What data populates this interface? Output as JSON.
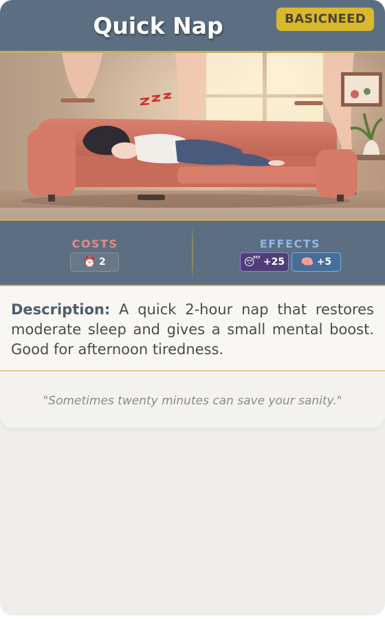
{
  "card": {
    "title": "Quick Nap",
    "type_badge": "BASICNEED",
    "colors": {
      "header": "#5c6f82",
      "badge": "#d9b82b",
      "gold_border": "#c9ad5e",
      "costs_title": "#e48a86",
      "effects_title": "#8fb8e6"
    }
  },
  "art": {
    "icon": "zzz-icon",
    "zzz_text": "z z z"
  },
  "costs": {
    "title": "COSTS",
    "items": [
      {
        "icon": "alarm-clock-icon",
        "emoji": "⏰",
        "value": "2"
      }
    ]
  },
  "effects": {
    "title": "EFFECTS",
    "items": [
      {
        "icon": "sleeping-face-icon",
        "emoji": "😴",
        "value": "+25"
      },
      {
        "icon": "brain-icon",
        "emoji": "🧠",
        "value": "+5"
      }
    ]
  },
  "description": {
    "label": "Description:",
    "text": "A quick 2-hour nap that restores moderate sleep and gives a small mental boost. Good for afternoon tiredness."
  },
  "flavor": {
    "text": "\"Sometimes twenty minutes can save your sanity.\""
  }
}
